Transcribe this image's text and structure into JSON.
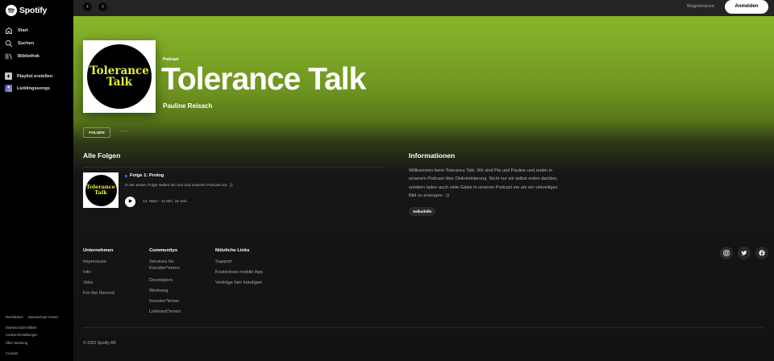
{
  "sidebar": {
    "brand": "Spotify",
    "nav": [
      {
        "label": "Start",
        "icon": "home-icon"
      },
      {
        "label": "Suchen",
        "icon": "search-icon"
      },
      {
        "label": "Bibliothek",
        "icon": "library-icon"
      }
    ],
    "actions": [
      {
        "label": "Playlist erstellen",
        "icon": "plus-icon"
      },
      {
        "label": "Lieblingssongs",
        "icon": "heart-icon"
      }
    ],
    "legal": [
      "Rechtliches",
      "Datenschutz-Center",
      "Datenschutzrichtlinie",
      "Cookie-Einstellungen",
      "Über Werbung",
      "Cookies"
    ]
  },
  "topbar": {
    "back": "‹",
    "forward": "›",
    "register": "Registrieren",
    "login": "Anmelden"
  },
  "show": {
    "cover_line1": "Tolerance",
    "cover_line2": "Talk",
    "kind": "Podcast",
    "title": "Tolerance Talk",
    "author": "Pauline Reisach",
    "follow": "FOLGEN",
    "more": "···"
  },
  "episodes": {
    "heading": "Alle Folgen",
    "items": [
      {
        "title": "Folge 1: Prolog",
        "description": "In der ersten Folge stellen wir uns und unseren Podcast vor. :))",
        "meta": "14. März · 11 Min. 16 Sek.",
        "cover_line1": "Tolerance",
        "cover_line2": "Talk"
      }
    ]
  },
  "info": {
    "heading": "Informationen",
    "text": "Willkommen beim Tolerance Talk. Wir sind Pia und Pauline und reden in unserem Podcast über Diskriminierung. Nicht nur wir selbst reden darüber, sondern laden auch viele Gäste in unseren Podcast ein um ein vielseitiges Bild zu erzeugen. :))",
    "chip": "Selbsthilfe"
  },
  "footer": {
    "columns": [
      {
        "title": "Unternehmen",
        "links": [
          "Impressum",
          "Info",
          "Jobs",
          "For the Record"
        ]
      },
      {
        "title": "Communitys",
        "links": [
          "Services für Künstler*innen",
          "Developers",
          "Werbung",
          "Investor*innen",
          "Lieferant*innen"
        ]
      },
      {
        "title": "Nützliche Links",
        "links": [
          "Support",
          "Kostenlose mobile App",
          "Verträge hier kündigen"
        ]
      }
    ],
    "social": [
      "instagram-icon",
      "twitter-icon",
      "facebook-icon"
    ],
    "copyright": "© 2023 Spotify AB"
  },
  "colors": {
    "accent_green": "#8fbd2c",
    "background": "#121212",
    "cover_text": "#e6ee3a",
    "episode_dot": "#2e77d0"
  }
}
